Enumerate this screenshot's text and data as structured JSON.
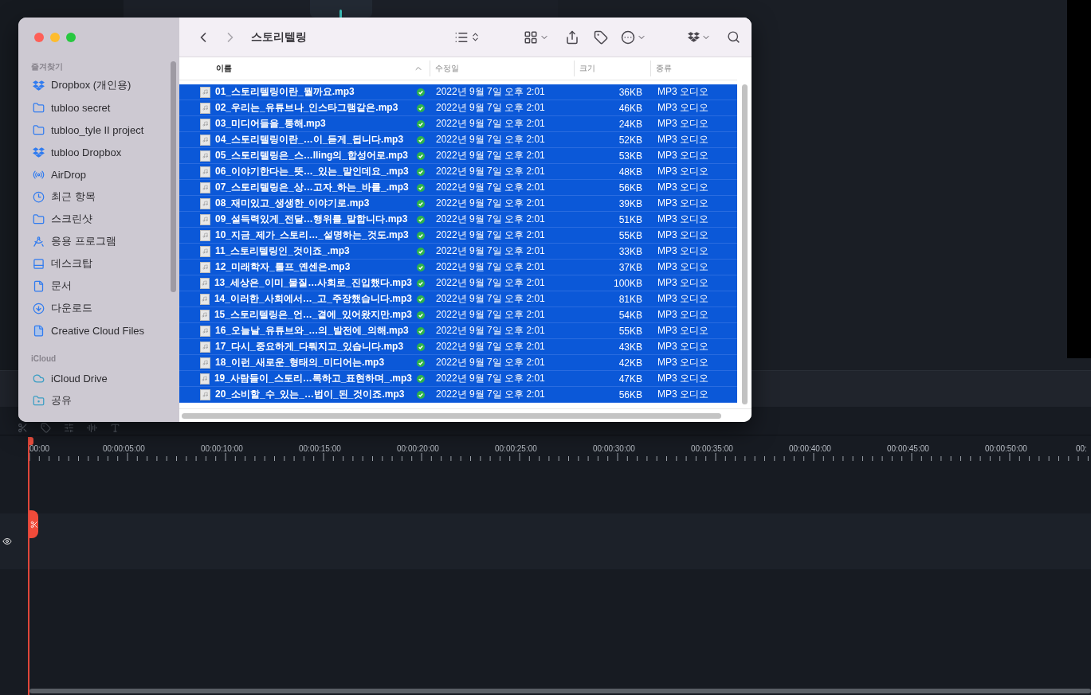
{
  "finder": {
    "title": "스토리텔링",
    "sidebar": [
      {
        "heading": "즐겨찾기",
        "items": [
          {
            "label": "Dropbox (개인용)",
            "selected": false
          },
          {
            "label": "tubloo secret",
            "selected": false
          },
          {
            "label": "tubloo_tyle II project",
            "selected": false
          },
          {
            "label": "tubloo Dropbox",
            "selected": false
          },
          {
            "label": "AirDrop",
            "selected": false
          },
          {
            "label": "최근 항목",
            "selected": false
          },
          {
            "label": "스크린샷",
            "selected": false
          },
          {
            "label": "응용 프로그램",
            "selected": false
          },
          {
            "label": "데스크탑",
            "selected": false
          },
          {
            "label": "문서",
            "selected": false
          },
          {
            "label": "다운로드",
            "selected": false
          },
          {
            "label": "Creative Cloud Files",
            "selected": false
          }
        ]
      },
      {
        "heading": "iCloud",
        "items": [
          {
            "label": "iCloud Drive",
            "selected": false
          },
          {
            "label": "공유",
            "selected": false
          }
        ]
      }
    ],
    "columns": [
      {
        "label": "이름",
        "sorted": true
      },
      {
        "label": "수정일",
        "sorted": false
      },
      {
        "label": "크기",
        "sorted": false
      },
      {
        "label": "종류",
        "sorted": false
      }
    ],
    "rows": [
      {
        "name": "01_스토리텔링이란_뭘까요.mp3",
        "modified": "2022년 9월 7일 오후 2:01",
        "size": "36KB",
        "type": "MP3 오디오",
        "synced": true,
        "selected": true
      },
      {
        "name": "02_우리는_유튜브나_인스타그램같은.mp3",
        "modified": "2022년 9월 7일 오후 2:01",
        "size": "46KB",
        "type": "MP3 오디오",
        "synced": true,
        "selected": true
      },
      {
        "name": "03_미디어들을_통해.mp3",
        "modified": "2022년 9월 7일 오후 2:01",
        "size": "24KB",
        "type": "MP3 오디오",
        "synced": true,
        "selected": true
      },
      {
        "name": "04_스토리텔링이란_…이_듣게_됩니다.mp3",
        "modified": "2022년 9월 7일 오후 2:01",
        "size": "52KB",
        "type": "MP3 오디오",
        "synced": true,
        "selected": true
      },
      {
        "name": "05_스토리텔링은_스…lling의_합성어로.mp3",
        "modified": "2022년 9월 7일 오후 2:01",
        "size": "53KB",
        "type": "MP3 오디오",
        "synced": true,
        "selected": true
      },
      {
        "name": "06_이야기한다는_뜻…_있는_말인데요_.mp3",
        "modified": "2022년 9월 7일 오후 2:01",
        "size": "48KB",
        "type": "MP3 오디오",
        "synced": true,
        "selected": true
      },
      {
        "name": "07_스토리텔링은_상…고자_하는_바를_.mp3",
        "modified": "2022년 9월 7일 오후 2:01",
        "size": "56KB",
        "type": "MP3 오디오",
        "synced": true,
        "selected": true
      },
      {
        "name": "08_재미있고_생생한_이야기로.mp3",
        "modified": "2022년 9월 7일 오후 2:01",
        "size": "39KB",
        "type": "MP3 오디오",
        "synced": true,
        "selected": true
      },
      {
        "name": "09_설득력있게_전달…행위를_말합니다.mp3",
        "modified": "2022년 9월 7일 오후 2:01",
        "size": "51KB",
        "type": "MP3 오디오",
        "synced": true,
        "selected": true
      },
      {
        "name": "10_지금_제가_스토리…_설명하는_것도.mp3",
        "modified": "2022년 9월 7일 오후 2:01",
        "size": "55KB",
        "type": "MP3 오디오",
        "synced": true,
        "selected": true
      },
      {
        "name": "11_스토리텔링인_것이죠_.mp3",
        "modified": "2022년 9월 7일 오후 2:01",
        "size": "33KB",
        "type": "MP3 오디오",
        "synced": true,
        "selected": true
      },
      {
        "name": "12_미래학자_롤프_옌센은.mp3",
        "modified": "2022년 9월 7일 오후 2:01",
        "size": "37KB",
        "type": "MP3 오디오",
        "synced": true,
        "selected": true
      },
      {
        "name": "13_세상은_이미_물질…사회로_진입했다.mp3",
        "modified": "2022년 9월 7일 오후 2:01",
        "size": "100KB",
        "type": "MP3 오디오",
        "synced": true,
        "selected": true
      },
      {
        "name": "14_이러한_사회에서…_고_주장했습니다.mp3",
        "modified": "2022년 9월 7일 오후 2:01",
        "size": "81KB",
        "type": "MP3 오디오",
        "synced": true,
        "selected": true
      },
      {
        "name": "15_스토리텔링은_언…_곁에_있어왔지만.mp3",
        "modified": "2022년 9월 7일 오후 2:01",
        "size": "54KB",
        "type": "MP3 오디오",
        "synced": true,
        "selected": true
      },
      {
        "name": "16_오늘날_유튜브와_…의_발전에_의해.mp3",
        "modified": "2022년 9월 7일 오후 2:01",
        "size": "55KB",
        "type": "MP3 오디오",
        "synced": true,
        "selected": true
      },
      {
        "name": "17_다시_중요하게_다뤄지고_있습니다.mp3",
        "modified": "2022년 9월 7일 오후 2:01",
        "size": "43KB",
        "type": "MP3 오디오",
        "synced": true,
        "selected": true
      },
      {
        "name": "18_이런_새로운_형태의_미디어는.mp3",
        "modified": "2022년 9월 7일 오후 2:01",
        "size": "42KB",
        "type": "MP3 오디오",
        "synced": true,
        "selected": true
      },
      {
        "name": "19_사람들이_스토리…록하고_표현하며_.mp3",
        "modified": "2022년 9월 7일 오후 2:01",
        "size": "47KB",
        "type": "MP3 오디오",
        "synced": true,
        "selected": true
      },
      {
        "name": "20_소비할_수_있는_…법이_된_것이죠.mp3",
        "modified": "2022년 9월 7일 오후 2:01",
        "size": "56KB",
        "type": "MP3 오디오",
        "synced": true,
        "selected": true
      }
    ]
  },
  "timeline": {
    "ruler_labels": [
      "00:00",
      "00:00:05:00",
      "00:00:10:00",
      "00:00:15:00",
      "00:00:20:00",
      "00:00:25:00",
      "00:00:30:00",
      "00:00:35:00",
      "00:00:40:00",
      "00:00:45:00",
      "00:00:50:00",
      "00:"
    ]
  }
}
